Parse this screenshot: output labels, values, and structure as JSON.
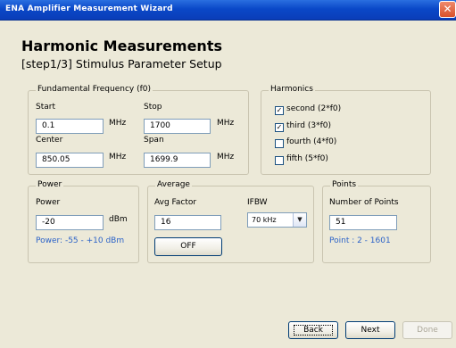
{
  "window": {
    "title": "ENA Amplifier Measurement Wizard"
  },
  "header": {
    "title": "Harmonic Measurements",
    "subtitle": "[step1/3] Stimulus Parameter Setup"
  },
  "fundamental": {
    "legend": "Fundamental Frequency (f0)",
    "start_label": "Start",
    "start_value": "0.1",
    "start_unit": "MHz",
    "stop_label": "Stop",
    "stop_value": "1700",
    "stop_unit": "MHz",
    "center_label": "Center",
    "center_value": "850.05",
    "center_unit": "MHz",
    "span_label": "Span",
    "span_value": "1699.9",
    "span_unit": "MHz"
  },
  "harmonics": {
    "legend": "Harmonics",
    "items": [
      {
        "label": "second (2*f0)",
        "checked": true
      },
      {
        "label": "third (3*f0)",
        "checked": true
      },
      {
        "label": "fourth (4*f0)",
        "checked": false
      },
      {
        "label": "fifth (5*f0)",
        "checked": false
      }
    ]
  },
  "power": {
    "legend": "Power",
    "label": "Power",
    "value": "-20",
    "unit": "dBm",
    "range": "Power: -55 - +10 dBm"
  },
  "average": {
    "legend": "Average",
    "factor_label": "Avg Factor",
    "factor_value": "16",
    "ifbw_label": "IFBW",
    "ifbw_value": "70 kHz",
    "toggle_label": "OFF"
  },
  "points": {
    "legend": "Points",
    "label": "Number of Points",
    "value": "51",
    "range": "Point : 2 - 1601"
  },
  "buttons": {
    "back": "Back",
    "next": "Next",
    "done": "Done"
  }
}
